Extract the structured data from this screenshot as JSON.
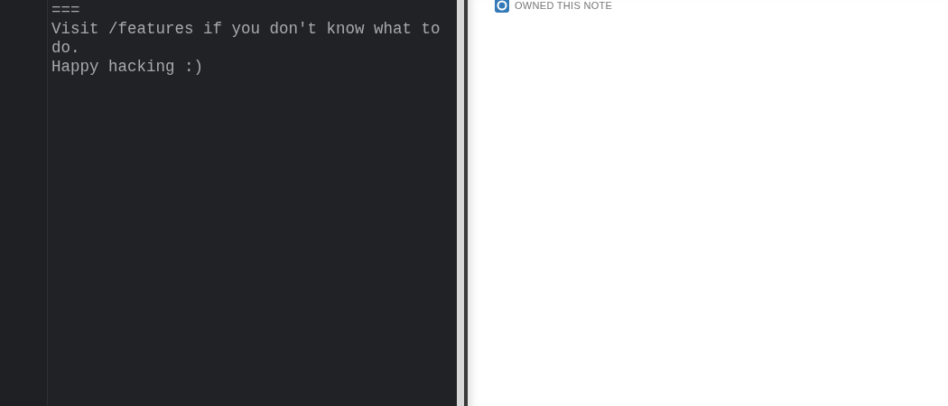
{
  "editor": {
    "lines": [
      "===",
      "Visit /features if you don't know what to do.",
      "Happy hacking :)"
    ]
  },
  "info_panel": {
    "owner_label": "OWNED THIS NOTE"
  }
}
